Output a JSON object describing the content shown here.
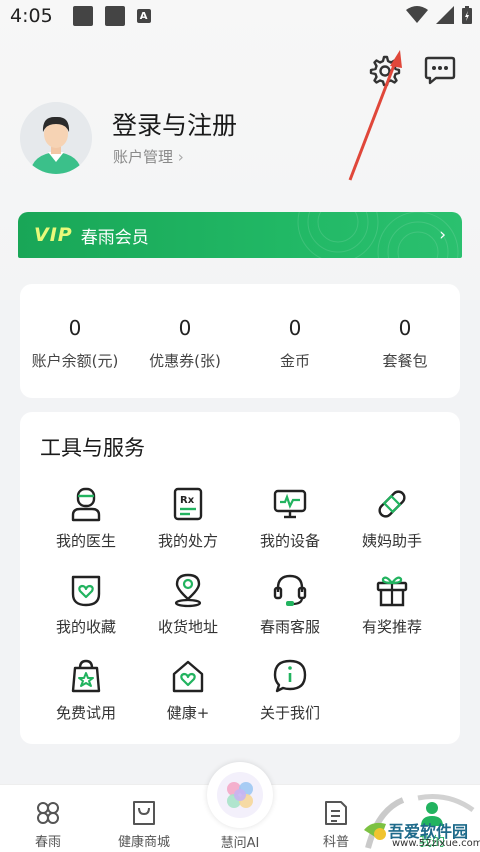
{
  "status_bar": {
    "time": "4:05",
    "a_badge": "A"
  },
  "profile": {
    "title": "登录与注册",
    "account_link": "账户管理"
  },
  "vip": {
    "badge": "VIP",
    "label": "春雨会员",
    "arrow": "›"
  },
  "stats": [
    {
      "value": "0",
      "label": "账户余额(元)"
    },
    {
      "value": "0",
      "label": "优惠券(张)"
    },
    {
      "value": "0",
      "label": "金币"
    },
    {
      "value": "0",
      "label": "套餐包"
    }
  ],
  "tools": {
    "title": "工具与服务",
    "items": [
      {
        "label": "我的医生",
        "icon": "doctor-icon"
      },
      {
        "label": "我的处方",
        "icon": "prescription-icon"
      },
      {
        "label": "我的设备",
        "icon": "device-icon"
      },
      {
        "label": "姨妈助手",
        "icon": "bandage-icon"
      },
      {
        "label": "我的收藏",
        "icon": "heart-collection-icon"
      },
      {
        "label": "收货地址",
        "icon": "location-icon"
      },
      {
        "label": "春雨客服",
        "icon": "headset-icon"
      },
      {
        "label": "有奖推荐",
        "icon": "gift-icon"
      },
      {
        "label": "免费试用",
        "icon": "shopping-bag-icon"
      },
      {
        "label": "健康+",
        "icon": "heart-house-icon"
      },
      {
        "label": "关于我们",
        "icon": "info-icon"
      }
    ]
  },
  "nav": {
    "items": [
      {
        "label": "春雨",
        "icon": "clover-icon"
      },
      {
        "label": "健康商城",
        "icon": "shop-bag-icon"
      },
      {
        "label": "慧问AI",
        "icon": "ai-orb-icon"
      },
      {
        "label": "科普",
        "icon": "article-icon"
      },
      {
        "label": "我的",
        "icon": "profile-icon"
      }
    ]
  },
  "watermark": {
    "text": "吾爱软件园",
    "url": "www.52zixue.com"
  },
  "colors": {
    "brand_green": "#1fb062",
    "accent_yellow": "#e9f97a",
    "annotation_arrow": "#e0473a"
  }
}
